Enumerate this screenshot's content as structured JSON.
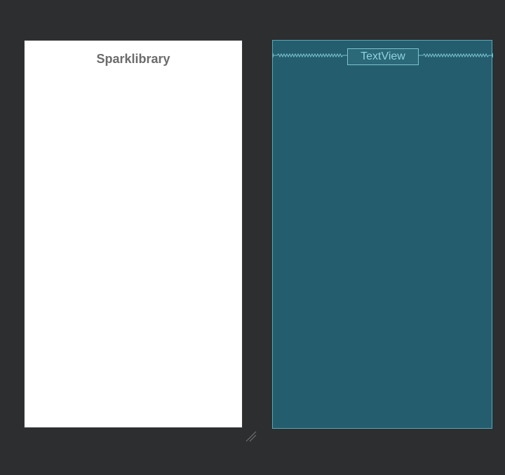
{
  "design_view": {
    "text": "Sparklibrary"
  },
  "blueprint_view": {
    "textview_label": "TextView"
  },
  "colors": {
    "workspace_background": "#2d2e30",
    "design_background": "#ffffff",
    "design_text": "#6b6b6b",
    "blueprint_background": "#245d6e",
    "blueprint_outline": "#5ba7b5",
    "blueprint_text": "#8fd3de"
  },
  "icons": {
    "resize_handle": "resize-handle-icon",
    "constraint_left": "constraint-spring-icon",
    "constraint_right": "constraint-spring-icon"
  }
}
